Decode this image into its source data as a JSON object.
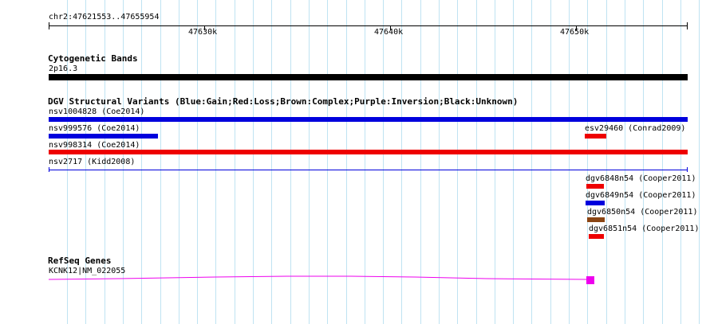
{
  "ruler": {
    "range_label": "chr2:47621553..47655954",
    "ticks": [
      {
        "label": "47630k"
      },
      {
        "label": "47640k"
      },
      {
        "label": "47650k"
      }
    ]
  },
  "cytoband": {
    "title": "Cytogenetic Bands",
    "band_label": "2p16.3",
    "color": "#000000"
  },
  "dgv": {
    "title": "DGV Structural Variants (Blue:Gain;Red:Loss;Brown:Complex;Purple:Inversion;Black:Unknown)",
    "colors": {
      "gain": "#0000dd",
      "loss": "#ee0000",
      "complex": "#8b4513",
      "inversion": "#800080",
      "unknown": "#000000"
    },
    "features": [
      {
        "label": "nsv1004828 (Coe2014)",
        "type": "gain"
      },
      {
        "label": "nsv999576 (Coe2014)",
        "type": "gain"
      },
      {
        "label": "esv29460 (Conrad2009)",
        "type": "loss"
      },
      {
        "label": "nsv998314 (Coe2014)",
        "type": "loss"
      },
      {
        "label": "nsv2717 (Kidd2008)",
        "type": "gain"
      },
      {
        "label": "dgv6848n54 (Cooper2011)",
        "type": "loss"
      },
      {
        "label": "dgv6849n54 (Cooper2011)",
        "type": "gain"
      },
      {
        "label": "dgv6850n54 (Cooper2011)",
        "type": "complex"
      },
      {
        "label": "dgv6851n54 (Cooper2011)",
        "type": "loss"
      }
    ]
  },
  "refseq": {
    "title": "RefSeq Genes",
    "gene_label": "KCNK12|NM_022055",
    "color": "#ee00ee"
  }
}
